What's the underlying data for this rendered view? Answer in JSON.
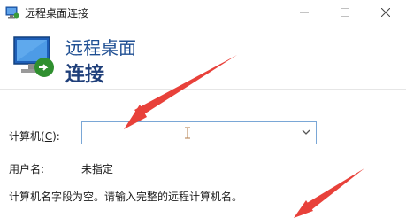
{
  "window": {
    "title": "远程桌面连接",
    "icon": "remote-desktop-icon",
    "controls": {
      "minimize": "minimize-icon",
      "maximize": "maximize-icon",
      "close": "close-icon"
    }
  },
  "header": {
    "title": "远程桌面",
    "subtitle": "连接",
    "icon": "remote-desktop-monitor-icon"
  },
  "form": {
    "computer_label_prefix": "计算机(",
    "computer_label_key": "C",
    "computer_label_suffix": "):",
    "computer_value": "",
    "username_label": "用户名:",
    "username_value": "未指定",
    "info_text": "计算机名字段为空。请输入完整的远程计算机名。"
  },
  "annotations": {
    "arrow_color": "#e8413a",
    "arrows": [
      "pointer-arrow-computer-field",
      "pointer-arrow-bottom"
    ]
  },
  "colors": {
    "title_blue": "#1f4f93",
    "subtitle_blue": "#1f3f7a",
    "field_border": "#7aa7d6"
  }
}
